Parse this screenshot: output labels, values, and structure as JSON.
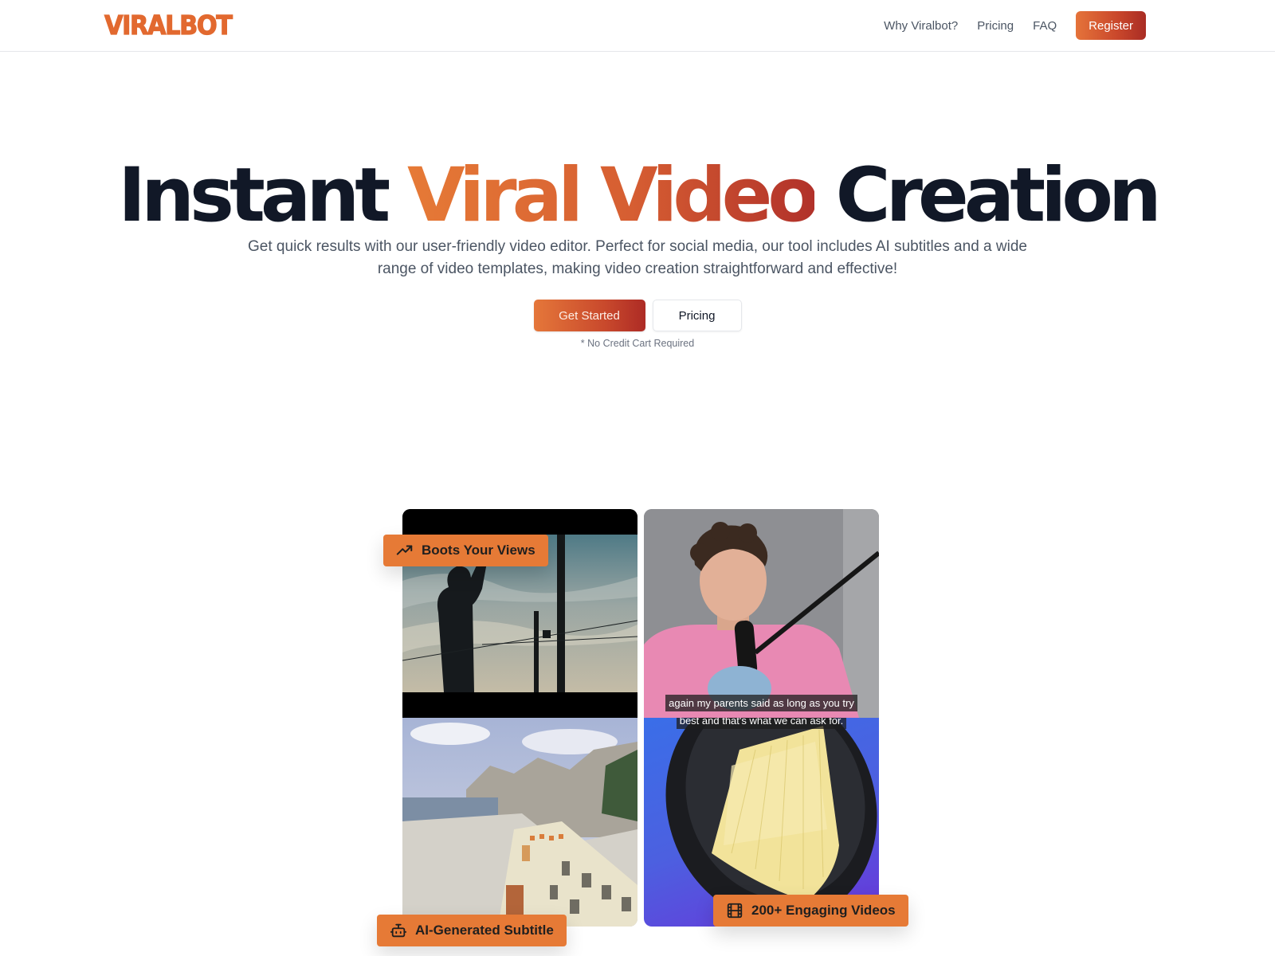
{
  "header": {
    "logo": "VIRALBOT",
    "nav": [
      {
        "label": "Why Viralbot?"
      },
      {
        "label": "Pricing"
      },
      {
        "label": "FAQ"
      }
    ],
    "register_label": "Register"
  },
  "hero": {
    "title_part1": "Instant",
    "title_highlight": "Viral Video",
    "title_part2": "Creation",
    "subtitle": "Get quick results with our user-friendly video editor. Perfect for social media, our tool includes AI subtitles and a wide range of video templates, making video creation straightforward and effective!",
    "primary_cta": "Get Started",
    "secondary_cta": "Pricing",
    "note": "* No Credit Cart Required"
  },
  "showcase": {
    "videos": [
      {
        "name": "silhouette-clip"
      },
      {
        "name": "podcast-clip"
      },
      {
        "name": "minecraft-clip"
      },
      {
        "name": "pasta-clip"
      }
    ],
    "caption_line1": "again my parents said as long as you try",
    "caption_line2": "best and that's what we can ask for.",
    "badges": [
      {
        "label": "Boots Your Views",
        "icon": "trending-up-icon"
      },
      {
        "label": "AI-Generated Subtitle",
        "icon": "robot-icon"
      },
      {
        "label": "200+ Engaging Videos",
        "icon": "film-icon"
      }
    ]
  },
  "colors": {
    "brand_orange": "#e67a36",
    "brand_red": "#ad2b25",
    "text_dark": "#111827",
    "text_muted": "#4b5563"
  }
}
